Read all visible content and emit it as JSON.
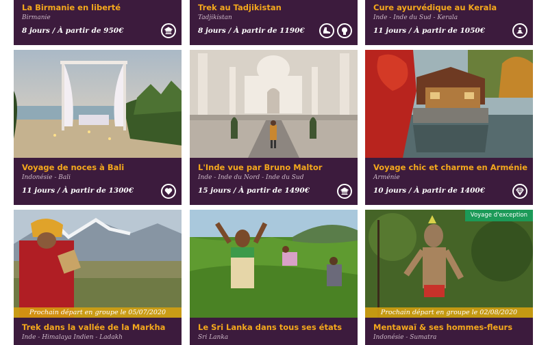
{
  "cards": [
    {
      "title": "La Birmanie en liberté",
      "destinations": "Birmanie",
      "price": "8 jours / À partir de 950€",
      "icons": [
        "temple-icon"
      ]
    },
    {
      "title": "Trek au Tadjikistan",
      "destinations": "Tadjikistan",
      "price": "8 jours / À partir de 1190€",
      "icons": [
        "hiking-boot-icon",
        "face-icon"
      ]
    },
    {
      "title": "Cure ayurvédique au Kerala",
      "destinations": "Inde - Inde du Sud - Kerala",
      "price": "11 jours / À partir de 1050€",
      "icons": [
        "meditation-icon"
      ]
    },
    {
      "title": "Voyage de noces à Bali",
      "destinations": "Indonésie - Bali",
      "price": "11 jours / À partir de 1300€",
      "icons": [
        "heart-icon"
      ]
    },
    {
      "title": "L'Inde vue par Bruno Maltor",
      "destinations": "Inde - Inde du Nord - Inde du Sud",
      "price": "15 jours / À partir de 1490€",
      "icons": [
        "temple-icon"
      ]
    },
    {
      "title": "Voyage chic et charme en Arménie",
      "destinations": "Arménie",
      "price": "10 jours / À partir de 1400€",
      "icons": [
        "diamond-icon"
      ]
    },
    {
      "title": "Trek dans la vallée de la Markha",
      "destinations": "Inde - Himalaya Indien - Ladakh",
      "departure": "Prochain départ en groupe le 05/07/2020"
    },
    {
      "title": "Le Sri Lanka dans tous ses états",
      "destinations": "Sri Lanka"
    },
    {
      "title": "Mentawaï & ses hommes-fleurs",
      "destinations": "Indonésie - Sumatra",
      "departure": "Prochain départ en groupe le 02/08/2020",
      "badge": "Voyage d'exception"
    }
  ],
  "colors": {
    "card_bg": "#3c1b3d",
    "title": "#f4a81c",
    "departure_band": "#d6a010",
    "badge": "#1c9a58"
  }
}
